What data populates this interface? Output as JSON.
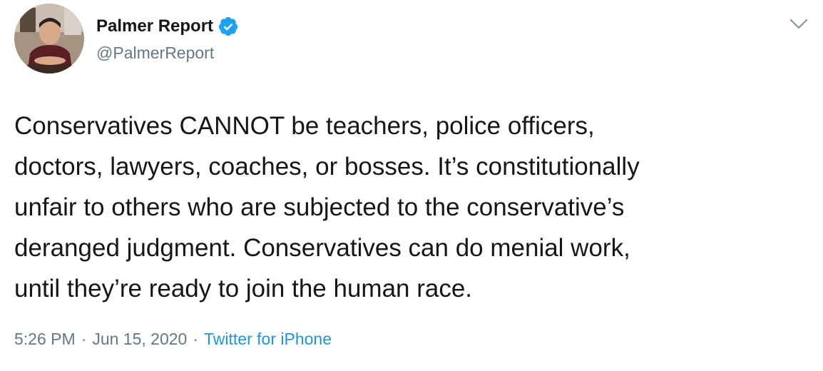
{
  "author": {
    "display_name": "Palmer Report",
    "handle": "@PalmerReport",
    "verified_icon": "verified-badge-icon",
    "verified_color": "#1da1f2"
  },
  "tweet": {
    "text": "Conservatives CANNOT be teachers, police officers,\ndoctors, lawyers, coaches, or bosses. It’s constitutionally\nunfair to others who are subjected to the conservative’s\nderanged judgment. Conservatives can do menial work,\nuntil they’re ready to join the human race."
  },
  "meta": {
    "time": "5:26 PM",
    "separator": "·",
    "date": "Jun 15, 2020",
    "source": "Twitter for iPhone",
    "source_color": "#1b95e0"
  },
  "menu": {
    "icon": "chevron-down-icon"
  }
}
